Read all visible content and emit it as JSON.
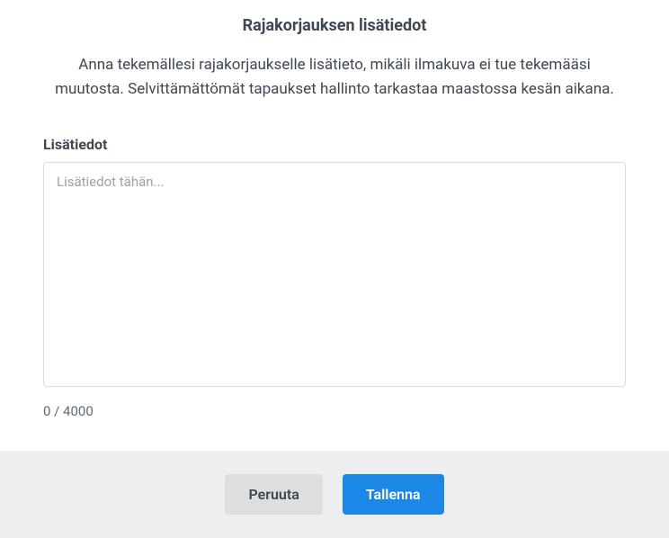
{
  "dialog": {
    "title": "Rajakorjauksen lisätiedot",
    "description": "Anna tekemällesi rajakorjaukselle lisätieto, mikäli ilmakuva ei tue tekemääsi muutosta. Selvittämättömät tapaukset hallinto tarkastaa maastossa kesän aikana."
  },
  "form": {
    "field_label": "Lisätiedot",
    "placeholder": "Lisätiedot tähän...",
    "value": "",
    "char_count": "0 / 4000"
  },
  "footer": {
    "cancel_label": "Peruuta",
    "save_label": "Tallenna"
  }
}
